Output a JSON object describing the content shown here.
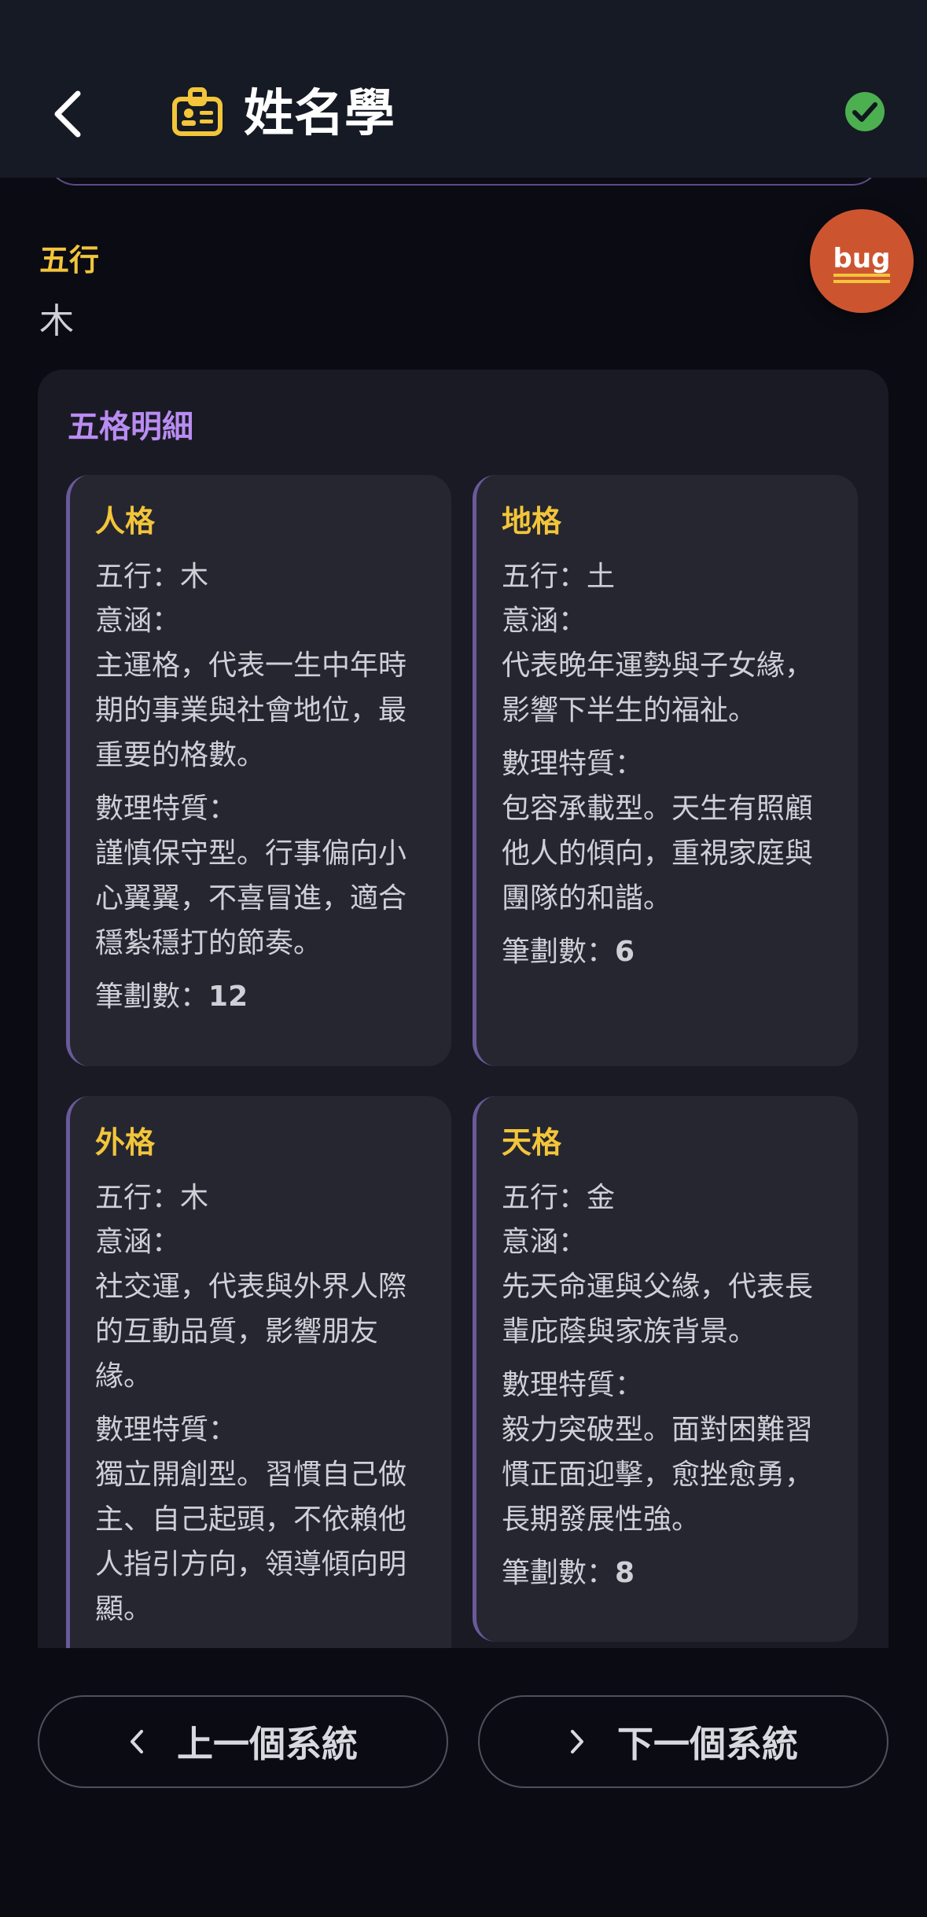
{
  "header": {
    "title": "姓名學",
    "back_icon": "chevron-left-icon",
    "title_icon": "id-badge-icon",
    "status_icon": "check-circle-icon",
    "accent": "#f2c53a",
    "status_color": "#4caf50"
  },
  "wuxing": {
    "label": "五行",
    "value": "木"
  },
  "bug_button": {
    "label": "bug",
    "color": "#cc5530"
  },
  "panel": {
    "title": "五格明細",
    "cards": [
      {
        "name": "人格",
        "wuxing": "五行：木",
        "meaning_label": "意涵：",
        "meaning": "主運格，代表一生中年時期的事業與社會地位，最重要的格數。",
        "trait_label": "數理特質：",
        "trait": "謹慎保守型。行事偏向小心翼翼，不喜冒進，適合穩紮穩打的節奏。",
        "strokes_label": "筆劃數：",
        "strokes": "12"
      },
      {
        "name": "地格",
        "wuxing": "五行：土",
        "meaning_label": "意涵：",
        "meaning": "代表晚年運勢與子女緣，影響下半生的福祉。",
        "trait_label": "數理特質：",
        "trait": "包容承載型。天生有照顧他人的傾向，重視家庭與團隊的和諧。",
        "strokes_label": "筆劃數：",
        "strokes": "6"
      },
      {
        "name": "外格",
        "wuxing": "五行：木",
        "meaning_label": "意涵：",
        "meaning": "社交運，代表與外界人際的互動品質，影響朋友緣。",
        "trait_label": "數理特質：",
        "trait": "獨立開創型。習慣自己做主、自己起頭，不依賴他人指引方向，領導傾向明顯。",
        "strokes_label": "",
        "strokes": ""
      },
      {
        "name": "天格",
        "wuxing": "五行：金",
        "meaning_label": "意涵：",
        "meaning": "先天命運與父緣，代表長輩庇蔭與家族背景。",
        "trait_label": "數理特質：",
        "trait": "毅力突破型。面對困難習慣正面迎擊，愈挫愈勇，長期發展性強。",
        "strokes_label": "筆劃數：",
        "strokes": "8"
      }
    ]
  },
  "nav": {
    "prev_label": "上一個系統",
    "next_label": "下一個系統",
    "prev_icon": "chevron-left-icon",
    "next_icon": "chevron-right-icon"
  },
  "colors": {
    "background": "#0b0b14",
    "panel": "#1a1a24",
    "card": "#262631",
    "card_title": "#f2c53a",
    "panel_title": "#b98cf2"
  }
}
